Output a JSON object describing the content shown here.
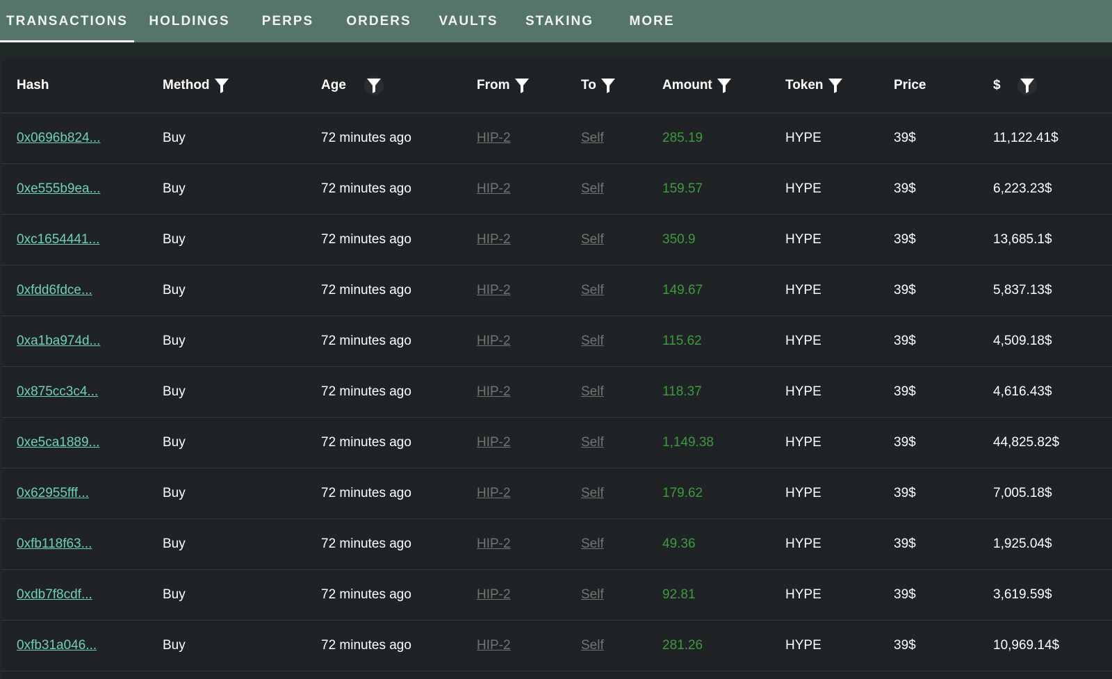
{
  "tabs": [
    {
      "label": "TRANSACTIONS",
      "active": true
    },
    {
      "label": "HOLDINGS",
      "active": false
    },
    {
      "label": "PERPS",
      "active": false
    },
    {
      "label": "ORDERS",
      "active": false
    },
    {
      "label": "VAULTS",
      "active": false
    },
    {
      "label": "STAKING",
      "active": false
    },
    {
      "label": "MORE",
      "active": false
    }
  ],
  "table": {
    "columns": [
      {
        "label": "Hash",
        "filter": false
      },
      {
        "label": "Method",
        "filter": true
      },
      {
        "label": "Age",
        "filter": true
      },
      {
        "label": "From",
        "filter": true
      },
      {
        "label": "To",
        "filter": true
      },
      {
        "label": "Amount",
        "filter": true
      },
      {
        "label": "Token",
        "filter": true
      },
      {
        "label": "Price",
        "filter": false
      },
      {
        "label": "$",
        "filter": true
      }
    ],
    "rows": [
      {
        "hash": "0x0696b824...",
        "method": "Buy",
        "age": "72 minutes ago",
        "from": "HIP-2",
        "to": "Self",
        "amount": "285.19",
        "token": "HYPE",
        "price": "39$",
        "usd": "11,122.41$"
      },
      {
        "hash": "0xe555b9ea...",
        "method": "Buy",
        "age": "72 minutes ago",
        "from": "HIP-2",
        "to": "Self",
        "amount": "159.57",
        "token": "HYPE",
        "price": "39$",
        "usd": "6,223.23$"
      },
      {
        "hash": "0xc1654441...",
        "method": "Buy",
        "age": "72 minutes ago",
        "from": "HIP-2",
        "to": "Self",
        "amount": "350.9",
        "token": "HYPE",
        "price": "39$",
        "usd": "13,685.1$"
      },
      {
        "hash": "0xfdd6fdce...",
        "method": "Buy",
        "age": "72 minutes ago",
        "from": "HIP-2",
        "to": "Self",
        "amount": "149.67",
        "token": "HYPE",
        "price": "39$",
        "usd": "5,837.13$"
      },
      {
        "hash": "0xa1ba974d...",
        "method": "Buy",
        "age": "72 minutes ago",
        "from": "HIP-2",
        "to": "Self",
        "amount": "115.62",
        "token": "HYPE",
        "price": "39$",
        "usd": "4,509.18$"
      },
      {
        "hash": "0x875cc3c4...",
        "method": "Buy",
        "age": "72 minutes ago",
        "from": "HIP-2",
        "to": "Self",
        "amount": "118.37",
        "token": "HYPE",
        "price": "39$",
        "usd": "4,616.43$"
      },
      {
        "hash": "0xe5ca1889...",
        "method": "Buy",
        "age": "72 minutes ago",
        "from": "HIP-2",
        "to": "Self",
        "amount": "1,149.38",
        "token": "HYPE",
        "price": "39$",
        "usd": "44,825.82$"
      },
      {
        "hash": "0x62955fff...",
        "method": "Buy",
        "age": "72 minutes ago",
        "from": "HIP-2",
        "to": "Self",
        "amount": "179.62",
        "token": "HYPE",
        "price": "39$",
        "usd": "7,005.18$"
      },
      {
        "hash": "0xfb118f63...",
        "method": "Buy",
        "age": "72 minutes ago",
        "from": "HIP-2",
        "to": "Self",
        "amount": "49.36",
        "token": "HYPE",
        "price": "39$",
        "usd": "1,925.04$"
      },
      {
        "hash": "0xdb7f8cdf...",
        "method": "Buy",
        "age": "72 minutes ago",
        "from": "HIP-2",
        "to": "Self",
        "amount": "92.81",
        "token": "HYPE",
        "price": "39$",
        "usd": "3,619.59$"
      },
      {
        "hash": "0xfb31a046...",
        "method": "Buy",
        "age": "72 minutes ago",
        "from": "HIP-2",
        "to": "Self",
        "amount": "281.26",
        "token": "HYPE",
        "price": "39$",
        "usd": "10,969.14$"
      }
    ]
  },
  "icons": {
    "filter": "filter-funnel-icon"
  },
  "colors": {
    "tabbar_bg": "#55746c",
    "panel_bg": "#202325",
    "hash_link": "#6fcfb8",
    "address_link": "#6e7672",
    "amount_positive": "#3e9a3e"
  }
}
